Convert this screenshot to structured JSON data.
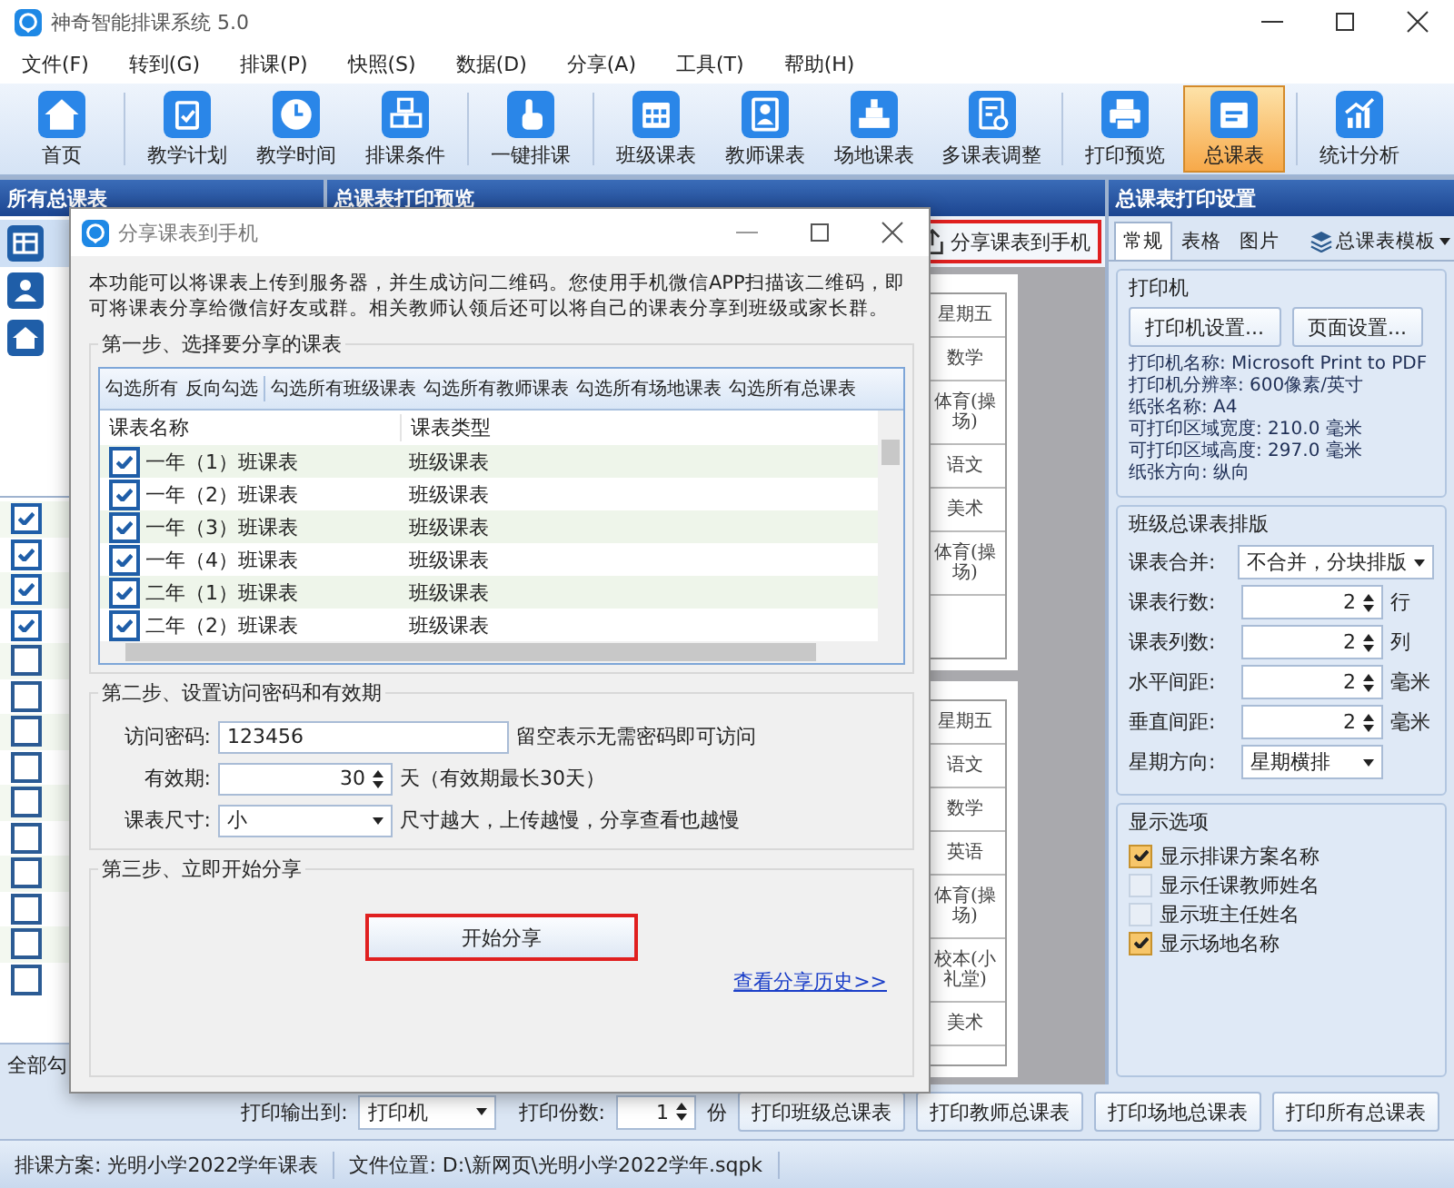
{
  "window": {
    "title": "神奇智能排课系统 5.0"
  },
  "menu": [
    "文件(F)",
    "转到(G)",
    "排课(P)",
    "快照(S)",
    "数据(D)",
    "分享(A)",
    "工具(T)",
    "帮助(H)"
  ],
  "toolbar": {
    "groups": [
      [
        {
          "label": "首页",
          "selected": false
        }
      ],
      [
        {
          "label": "教学计划",
          "selected": false
        },
        {
          "label": "教学时间",
          "selected": false
        },
        {
          "label": "排课条件",
          "selected": false
        }
      ],
      [
        {
          "label": "一键排课",
          "selected": false
        }
      ],
      [
        {
          "label": "班级课表",
          "selected": false
        },
        {
          "label": "教师课表",
          "selected": false
        },
        {
          "label": "场地课表",
          "selected": false
        },
        {
          "label": "多课表调整",
          "selected": false
        }
      ],
      [
        {
          "label": "打印预览",
          "selected": false
        },
        {
          "label": "总课表",
          "selected": true
        }
      ],
      [
        {
          "label": "统计分析",
          "selected": false
        }
      ]
    ]
  },
  "left_panel": {
    "title": "所有总课表",
    "categories": [
      {
        "selected": true
      },
      {
        "selected": false
      },
      {
        "selected": false
      }
    ],
    "items": [
      {
        "checked": true
      },
      {
        "checked": true
      },
      {
        "checked": true
      },
      {
        "checked": true
      },
      {
        "checked": false
      },
      {
        "checked": false
      },
      {
        "checked": false
      },
      {
        "checked": false
      },
      {
        "checked": false
      },
      {
        "checked": false
      },
      {
        "checked": false
      },
      {
        "checked": false
      },
      {
        "checked": false
      },
      {
        "checked": false
      }
    ],
    "footer": "全部勾"
  },
  "preview": {
    "title": "总课表打印预览",
    "share_button": "分享课表到手机",
    "pages": [
      {
        "cells": [
          "星期五",
          "数学",
          "体育(操场)",
          "语文",
          "美术",
          "体育(操场)"
        ]
      },
      {
        "cells": [
          "星期五",
          "语文",
          "数学",
          "英语",
          "体育(操场)",
          "校本(小礼堂)",
          "美术"
        ]
      }
    ]
  },
  "settings": {
    "title": "总课表打印设置",
    "tabs": [
      {
        "label": "常规",
        "selected": true
      },
      {
        "label": "表格",
        "selected": false
      },
      {
        "label": "图片",
        "selected": false
      }
    ],
    "template_button": "总课表模板",
    "printer": {
      "title": "打印机",
      "buttons": [
        "打印机设置...",
        "页面设置..."
      ],
      "info": [
        "打印机名称: Microsoft Print to PDF",
        "打印机分辨率: 600像素/英寸",
        "纸张名称: A4",
        "可打印区域宽度: 210.0 毫米",
        "可打印区域高度: 297.0 毫米",
        "纸张方向: 纵向"
      ]
    },
    "layout": {
      "title": "班级总课表排版",
      "fields": [
        {
          "label": "课表合并:",
          "kind": "select",
          "value": "不合并，分块排版"
        },
        {
          "label": "课表行数:",
          "kind": "spin",
          "value": "2",
          "unit": "行"
        },
        {
          "label": "课表列数:",
          "kind": "spin",
          "value": "2",
          "unit": "列"
        },
        {
          "label": "水平间距:",
          "kind": "spin",
          "value": "2",
          "unit": "毫米"
        },
        {
          "label": "垂直间距:",
          "kind": "spin",
          "value": "2",
          "unit": "毫米"
        },
        {
          "label": "星期方向:",
          "kind": "select",
          "value": "星期横排"
        }
      ]
    },
    "display": {
      "title": "显示选项",
      "options": [
        {
          "label": "显示排课方案名称",
          "checked": true
        },
        {
          "label": "显示任课教师姓名",
          "checked": false
        },
        {
          "label": "显示班主任姓名",
          "checked": false
        },
        {
          "label": "显示场地名称",
          "checked": true
        }
      ]
    }
  },
  "bottom_bar": {
    "output_label": "打印输出到:",
    "output_value": "打印机",
    "copies_label": "打印份数:",
    "copies_value": "1",
    "copies_unit": "份",
    "buttons": [
      "打印班级总课表",
      "打印教师总课表",
      "打印场地总课表",
      "打印所有总课表"
    ]
  },
  "status_bar": [
    "排课方案: 光明小学2022学年课表",
    "文件位置: D:\\新网页\\光明小学2022学年.sqpk"
  ],
  "dialog": {
    "title": "分享课表到手机",
    "description": "本功能可以将课表上传到服务器，并生成访问二维码。您使用手机微信APP扫描该二维码，即可将课表分享给微信好友或群。相关教师认领后还可以将自己的课表分享到班级或家长群。",
    "step1": {
      "title": "第一步、选择要分享的课表",
      "actions": [
        "勾选所有",
        "反向勾选",
        "勾选所有班级课表",
        "勾选所有教师课表",
        "勾选所有场地课表",
        "勾选所有总课表"
      ],
      "columns": [
        "课表名称",
        "课表类型"
      ],
      "rows": [
        {
          "name": "一年（1）班课表",
          "type": "班级课表",
          "checked": true
        },
        {
          "name": "一年（2）班课表",
          "type": "班级课表",
          "checked": true
        },
        {
          "name": "一年（3）班课表",
          "type": "班级课表",
          "checked": true
        },
        {
          "name": "一年（4）班课表",
          "type": "班级课表",
          "checked": true
        },
        {
          "name": "二年（1）班课表",
          "type": "班级课表",
          "checked": true
        },
        {
          "name": "二年（2）班课表",
          "type": "班级课表",
          "checked": true
        }
      ]
    },
    "step2": {
      "title": "第二步、设置访问密码和有效期",
      "fields": [
        {
          "label": "访问密码:",
          "kind": "text",
          "value": "123456",
          "hint": "留空表示无需密码即可访问"
        },
        {
          "label": "有效期:",
          "kind": "spin",
          "value": "30",
          "hint": "天（有效期最长30天）"
        },
        {
          "label": "课表尺寸:",
          "kind": "select",
          "value": "小",
          "hint": "尺寸越大，上传越慢，分享查看也越慢"
        }
      ]
    },
    "step3": {
      "title": "第三步、立即开始分享",
      "button": "开始分享",
      "link": "查看分享历史>>"
    }
  }
}
